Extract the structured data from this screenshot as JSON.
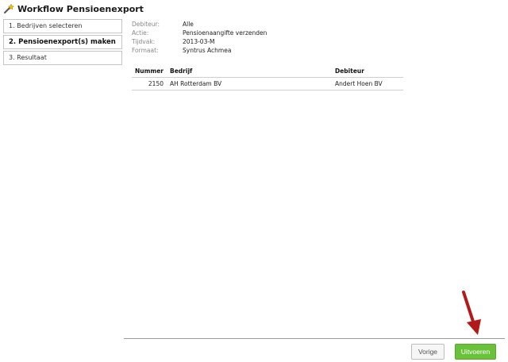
{
  "window": {
    "title": "Workflow Pensioenexport",
    "icon": "wand-icon"
  },
  "steps": [
    {
      "label": "1. Bedrijven selecteren",
      "active": false
    },
    {
      "label": "2. Pensioenexport(s) maken",
      "active": true
    },
    {
      "label": "3. Resultaat",
      "active": false
    }
  ],
  "meta": {
    "debiteur": {
      "label": "Debiteur:",
      "value": "Alle"
    },
    "actie": {
      "label": "Actie:",
      "value": "Pensioenaangifte verzenden"
    },
    "tijdvak": {
      "label": "Tijdvak:",
      "value": "2013-03-M"
    },
    "formaat": {
      "label": "Formaat:",
      "value": "Syntrus Achmea"
    }
  },
  "table": {
    "headers": {
      "nummer": "Nummer",
      "bedrijf": "Bedrijf",
      "debiteur": "Debiteur"
    },
    "rows": [
      {
        "nummer": "2150",
        "bedrijf": "AH Rotterdam BV",
        "debiteur": "Andert Hoen BV"
      }
    ]
  },
  "buttons": {
    "prev": "Vorige",
    "run": "Uitvoeren"
  },
  "colors": {
    "run_button": "#6ac23a",
    "arrow": "#b21a1a"
  }
}
